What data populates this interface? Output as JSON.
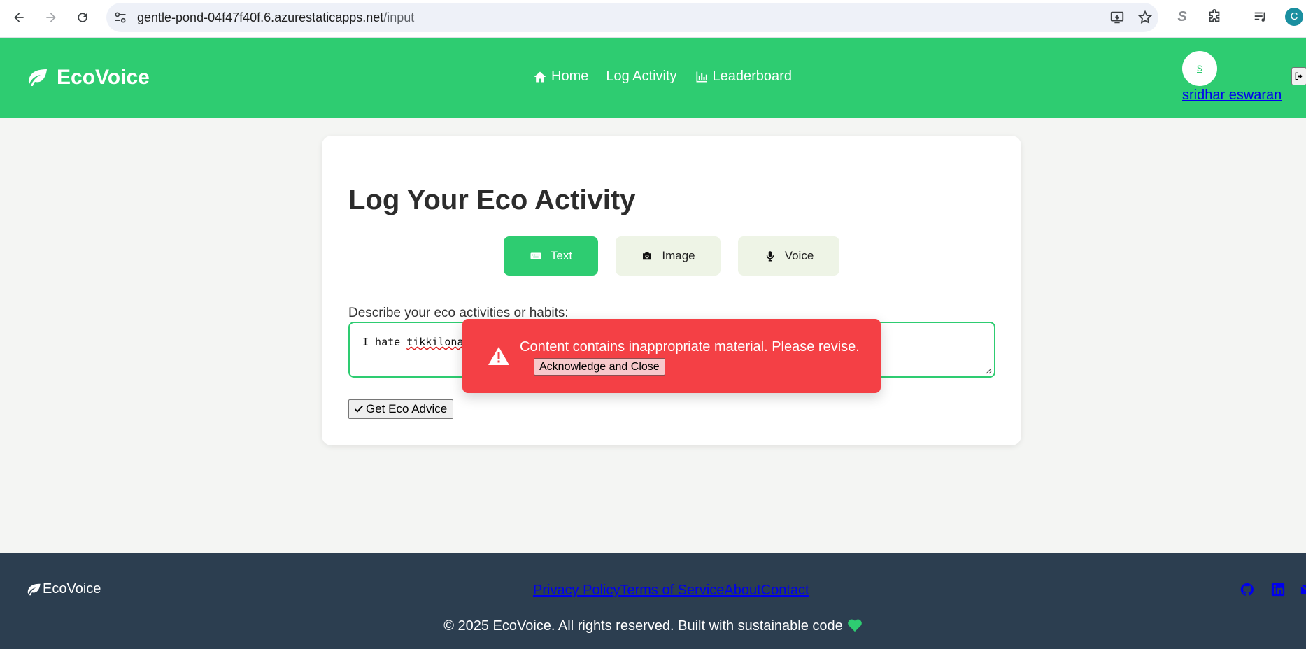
{
  "browser": {
    "url_host": "gentle-pond-04f47f40f.6.azurestaticapps.net",
    "url_path": "/input",
    "profile_initial": "C",
    "extension_letter": "S"
  },
  "header": {
    "brand": "EcoVoice",
    "nav": [
      {
        "label": "Home",
        "icon": "home-icon"
      },
      {
        "label": "Log Activity"
      },
      {
        "label": "Leaderboard",
        "icon": "chart-icon"
      }
    ],
    "avatar_initial": "s",
    "user_name": "sridhar eswaran"
  },
  "card": {
    "title": "Log Your Eco Activity",
    "modes": [
      {
        "label": "Text",
        "icon": "keyboard-icon",
        "active": true
      },
      {
        "label": "Image",
        "icon": "camera-icon",
        "active": false
      },
      {
        "label": "Voice",
        "icon": "microphone-icon",
        "active": false
      }
    ],
    "field_label": "Describe your eco activities or habits:",
    "textarea_value_plain": "I hate ",
    "textarea_value_flagged": "tikkilona",
    "submit_label": "Get Eco Advice"
  },
  "alert": {
    "message": "Content contains inappropriate material. Please revise.",
    "button_label": "Acknowledge and Close"
  },
  "footer": {
    "brand": "EcoVoice",
    "links": [
      "Privacy Policy",
      "Terms of Service",
      "About",
      "Contact"
    ],
    "copyright": "© 2025 EcoVoice. All rights reserved. Built with sustainable code"
  },
  "colors": {
    "primary": "#2ecc71",
    "alert": "#f44045",
    "footer": "#2c3e50",
    "mode_inactive": "#eef4e6"
  }
}
